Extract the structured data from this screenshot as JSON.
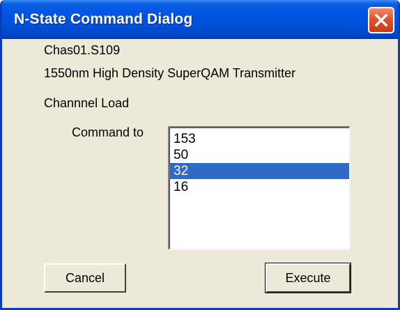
{
  "window": {
    "title": "N-State Command Dialog",
    "close_icon": "close-icon"
  },
  "info": {
    "device": "Chas01.S109",
    "description": "1550nm High Density SuperQAM Transmitter",
    "parameter": "Channnel Load"
  },
  "command": {
    "label": "Command to",
    "options": [
      "153",
      "50",
      "32",
      "16"
    ],
    "selected": "32"
  },
  "buttons": {
    "cancel_label": "Cancel",
    "execute_label": "Execute"
  },
  "colors": {
    "titlebar": "#0054e3",
    "dialog_bg": "#ece9d8",
    "selection": "#316ac5",
    "close_button": "#e0532f"
  }
}
